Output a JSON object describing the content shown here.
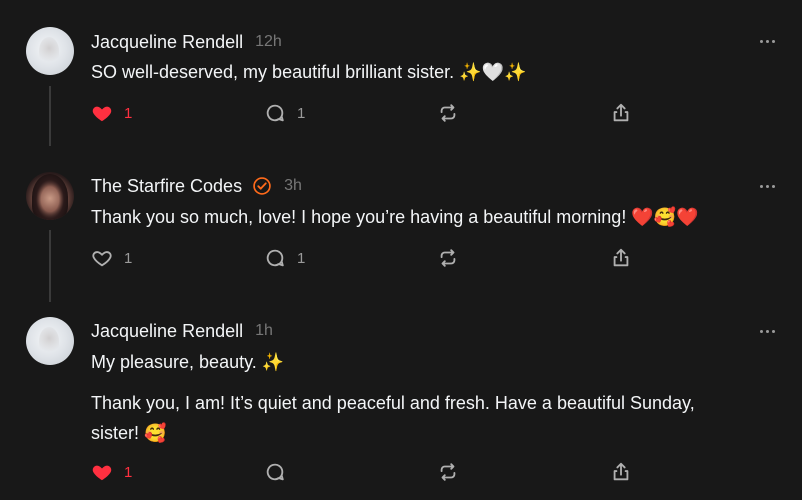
{
  "posts": [
    {
      "author": "Jacqueline Rendell",
      "time": "12h",
      "text": "SO well-deserved, my beautiful brilliant sister. ✨🤍✨",
      "text2": "",
      "liked": true,
      "likes": "1",
      "replies": "1",
      "verified": false
    },
    {
      "author": "The Starfire Codes",
      "time": "3h",
      "text": "Thank you so much, love! I hope you’re having a beautiful morning! ❤️🥰❤️",
      "text2": "",
      "liked": false,
      "likes": "1",
      "replies": "1",
      "verified": true
    },
    {
      "author": "Jacqueline Rendell",
      "time": "1h",
      "text": "My pleasure, beauty. ✨",
      "text2": "Thank you, I am! It’s quiet and peaceful and fresh. Have a beautiful Sunday,\nsister! 🥰",
      "liked": true,
      "likes": "1",
      "replies": "",
      "verified": false
    }
  ],
  "colors": {
    "background": "#181818",
    "like": "#ff3040",
    "verified": "#ff6a1a",
    "muted": "#9a9a9a"
  },
  "icons": {
    "like": "heart-icon",
    "reply": "comment-icon",
    "repost": "repost-icon",
    "share": "share-icon",
    "more": "more-icon",
    "verified": "verified-badge-icon"
  }
}
